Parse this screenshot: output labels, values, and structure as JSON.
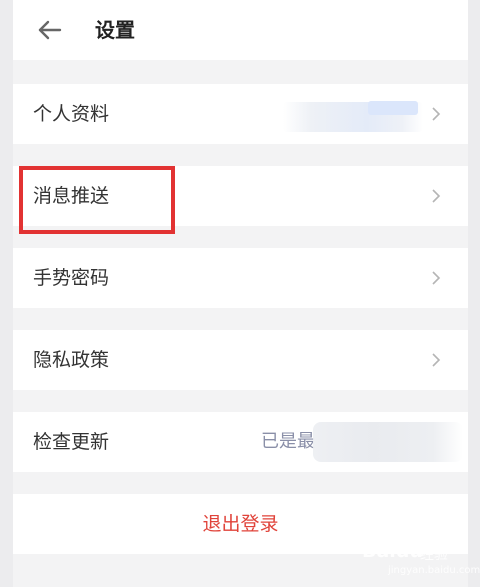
{
  "header": {
    "title": "设置",
    "back_icon": "arrow-left-icon"
  },
  "rows": [
    {
      "label": "个人资料",
      "value": ""
    },
    {
      "label": "消息推送"
    },
    {
      "label": "手势密码"
    },
    {
      "label": "隐私政策"
    },
    {
      "label": "检查更新",
      "value": "已是最"
    }
  ],
  "logout": {
    "label": "退出登录"
  },
  "watermark": {
    "logo": "Baidu",
    "text": "经验",
    "sub": "jingyan.baidu.com"
  },
  "colors": {
    "accent_red": "#e0433a",
    "highlight_border": "#e23232",
    "value_text": "#8a8fa8"
  }
}
